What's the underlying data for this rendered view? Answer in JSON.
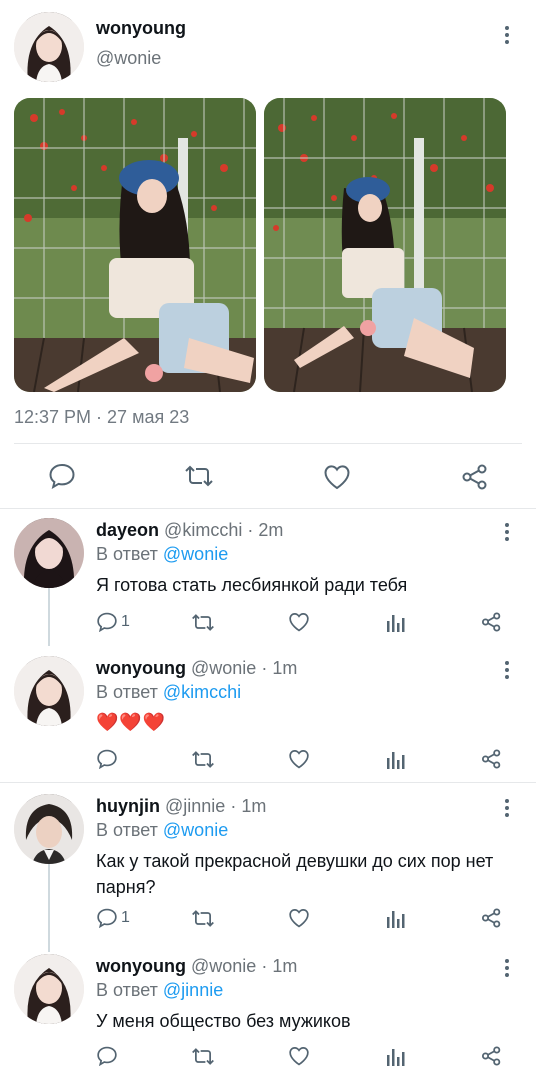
{
  "tweet": {
    "author_name": "wonyoung",
    "author_handle": "@wonie",
    "timestamp": "12:37 PM · 27 мая 23"
  },
  "replies": [
    {
      "name": "dayeon",
      "handle": "@kimcchi",
      "time": "· 2m",
      "reply_prefix": "В ответ",
      "reply_to": "@wonie",
      "text": "Я готова стать лесбиянкой ради тебя",
      "reply_count": "1"
    },
    {
      "name": "wonyoung",
      "handle": "@wonie",
      "time": "· 1m",
      "reply_prefix": "В ответ",
      "reply_to": "@kimcchi",
      "text": "❤️❤️❤️",
      "reply_count": ""
    },
    {
      "name": "huynjin",
      "handle": "@jinnie",
      "time": "· 1m",
      "reply_prefix": "В ответ",
      "reply_to": "@wonie",
      "text": "Как у такой прекрасной девушки до сих пор нет парня?",
      "reply_count": "1"
    },
    {
      "name": "wonyoung",
      "handle": "@wonie",
      "time": "· 1m",
      "reply_prefix": "В ответ",
      "reply_to": "@jinnie",
      "text": "У меня общество без мужиков",
      "reply_count": ""
    }
  ],
  "colors": {
    "accent": "#1d9bf0",
    "muted": "#536471",
    "heart": "#f4704c"
  },
  "icons": [
    "more-icon",
    "comment-icon",
    "retweet-icon",
    "like-icon",
    "share-icon",
    "analytics-icon"
  ]
}
